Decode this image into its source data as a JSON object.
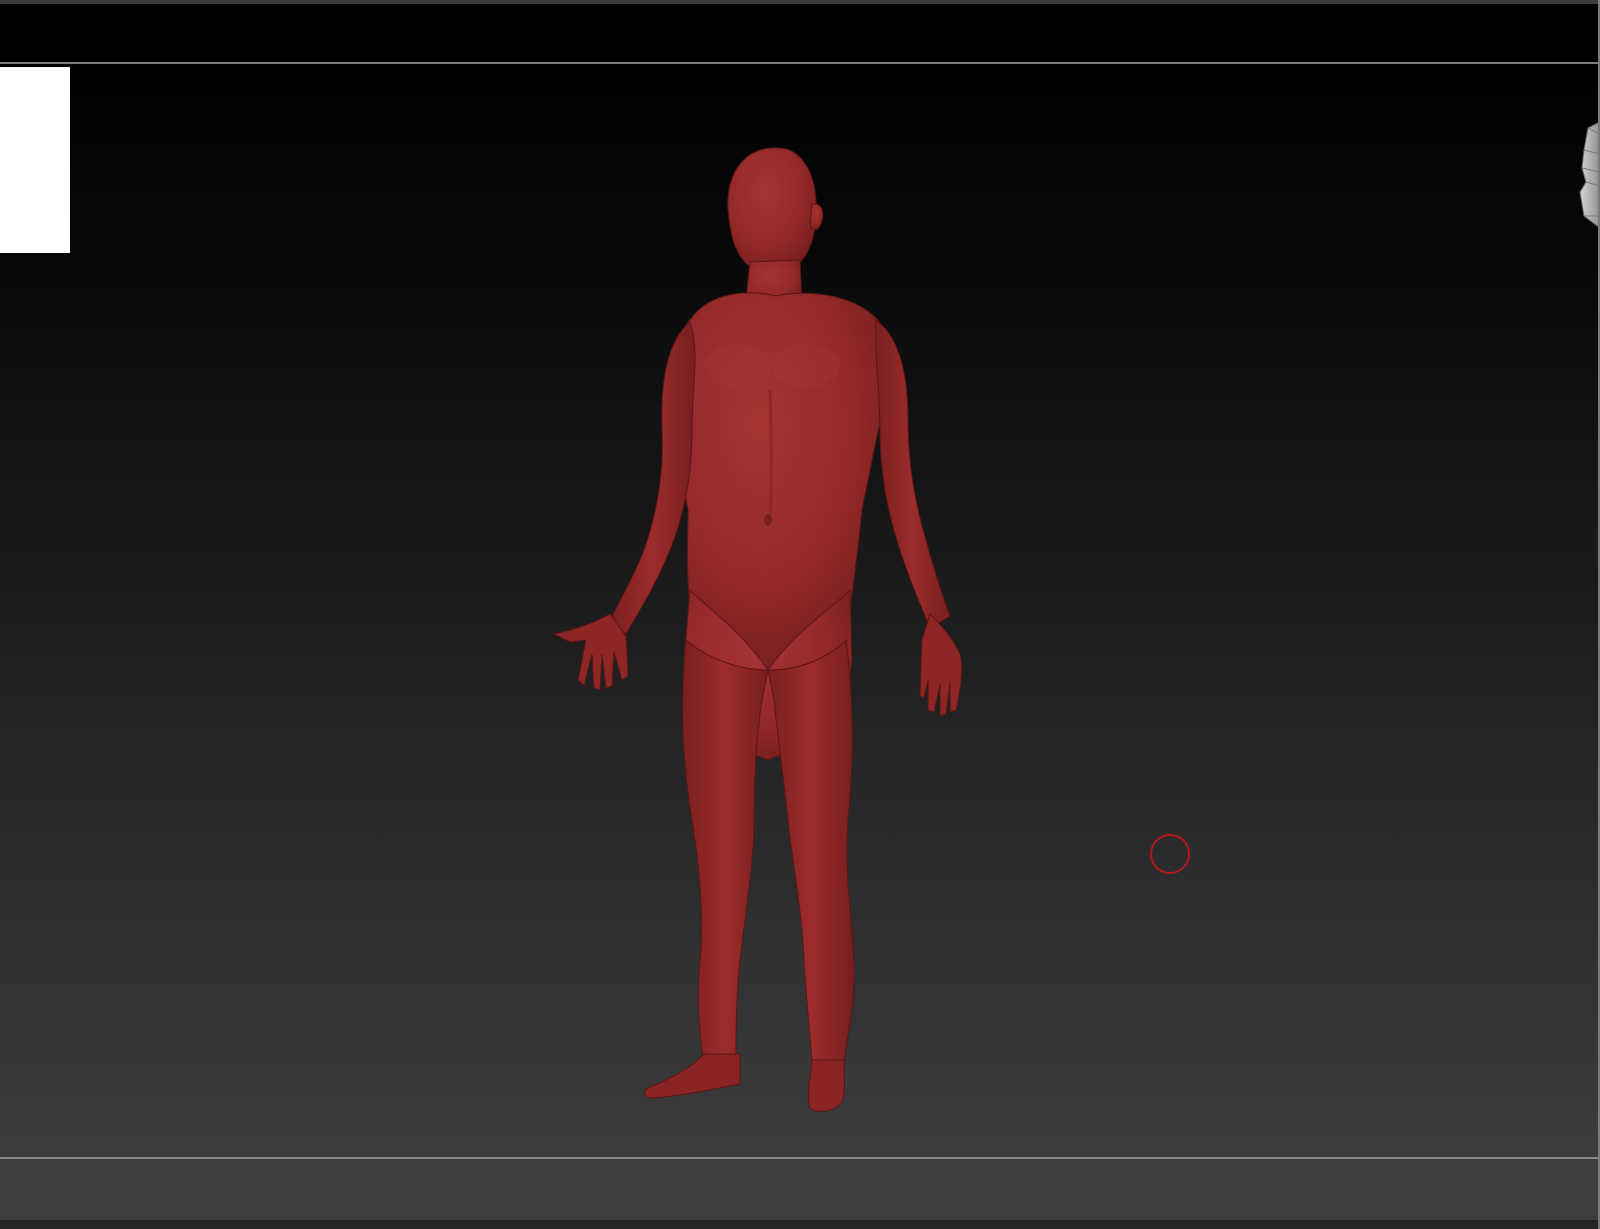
{
  "app": {
    "window_title": ""
  },
  "viewport": {
    "model": {
      "icon": "human-figure-icon",
      "material_color": "#9b2a2a"
    },
    "background_top_color": "#000000",
    "background_bottom_color": "#3c3c3c"
  },
  "navigation": {
    "icon": "view-cube-icon"
  },
  "brush": {
    "icon": "brush-cursor-icon",
    "color": "#b0161c"
  }
}
